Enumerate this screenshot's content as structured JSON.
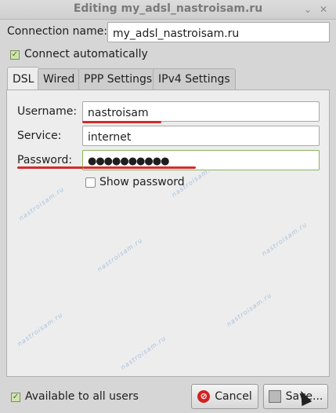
{
  "window": {
    "title": "Editing my_adsl_nastroisam.ru",
    "controls": [
      "minimize-icon",
      "close-icon"
    ]
  },
  "connection": {
    "name_label": "Connection name:",
    "name_value": "my_adsl_nastroisam.ru",
    "auto_label": "Connect automatically",
    "auto_checked": true
  },
  "tabs": [
    {
      "label": "DSL",
      "active": true
    },
    {
      "label": "Wired",
      "active": false
    },
    {
      "label": "PPP Settings",
      "active": false
    },
    {
      "label": "IPv4 Settings",
      "active": false
    }
  ],
  "dsl": {
    "username_label": "Username:",
    "username_value": "nastroisam",
    "service_label": "Service:",
    "service_value": "internet",
    "password_label": "Password:",
    "password_value": "●●●●●●●●●●",
    "show_password_label": "Show password",
    "show_password_checked": false
  },
  "footer": {
    "all_users_label": "Available to all users",
    "all_users_checked": true,
    "cancel_label": "Cancel",
    "save_label": "Save..."
  },
  "watermark": "nastroisam.ru",
  "colors": {
    "annotation_underline": "#d42b2b",
    "active_entry_border": "#8bb35e",
    "checkbox_green": "#cfe3b0"
  }
}
